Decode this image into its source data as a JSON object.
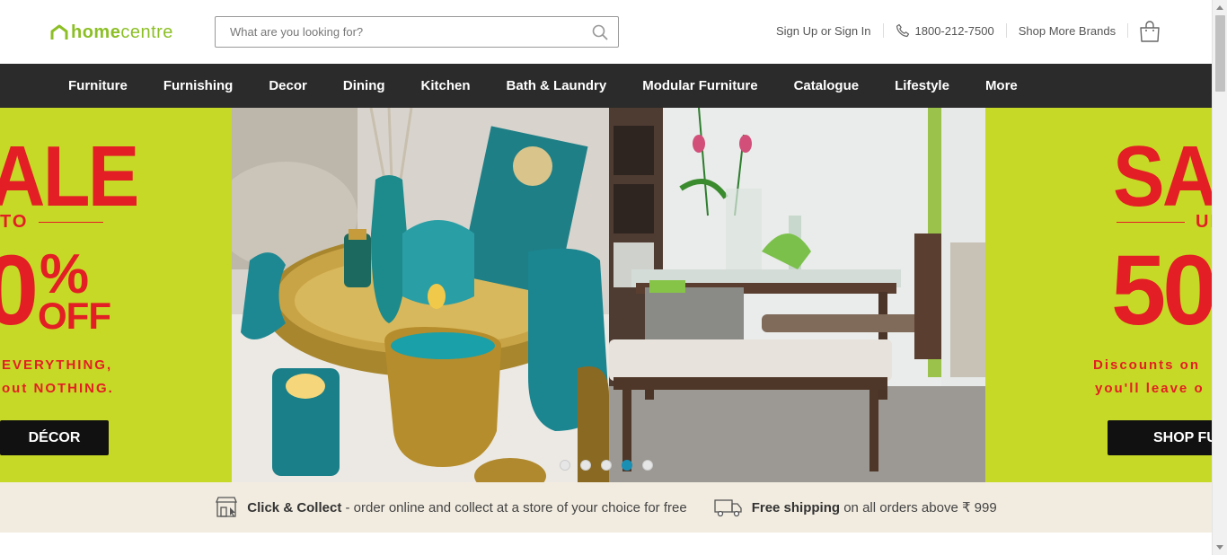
{
  "brand": {
    "name_bold": "home",
    "name_light": "centre",
    "color": "#8cbf26"
  },
  "search": {
    "placeholder": "What are you looking for?"
  },
  "header_links": {
    "signin": "Sign Up or Sign In",
    "phone": "1800-212-7500",
    "brands": "Shop More Brands"
  },
  "nav": {
    "items": [
      "Furniture",
      "Furnishing",
      "Decor",
      "Dining",
      "Kitchen",
      "Bath & Laundry",
      "Modular Furniture",
      "Catalogue",
      "Lifestyle",
      "More"
    ]
  },
  "banner": {
    "left": {
      "big": "ALE",
      "upto": "TO",
      "pct": "0",
      "pct_sign": "%",
      "off": "OFF",
      "line1": "EVERYTHING,",
      "line2": "out NOTHING.",
      "cta": "DÉCOR"
    },
    "right": {
      "big": "SA",
      "upto": "UP",
      "pct": "50",
      "line1": "Discounts on",
      "line2": "you'll leave o",
      "cta": "SHOP FU"
    },
    "slides": 5,
    "active_slide": 3,
    "colors": {
      "lime": "#c7d927",
      "red": "#e31e24",
      "dot_active": "#1a8fb4"
    }
  },
  "strip": {
    "collect_bold": "Click & Collect",
    "collect_rest": " - order online and collect at a store of your choice for free",
    "ship_bold": "Free shipping",
    "ship_rest": " on all orders above ₹ 999"
  }
}
